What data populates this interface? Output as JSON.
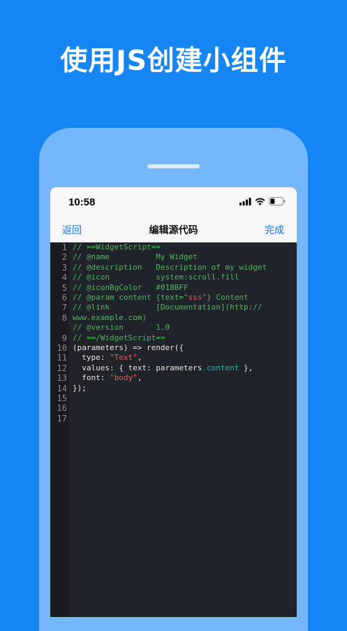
{
  "headline": "使用JS创建小组件",
  "status": {
    "time": "10:58"
  },
  "nav": {
    "back": "返回",
    "title": "编辑源代码",
    "done": "完成"
  },
  "colors": {
    "background": "#1686f5",
    "phone": "#74b8fb",
    "editor_bg": "#21232b",
    "accent": "#1677ee",
    "comment": "#52b560",
    "string": "#e25b5b",
    "property": "#34b0b3"
  },
  "code_lines": [
    {
      "n": "1",
      "segments": [
        {
          "t": "// ==WidgetScript==",
          "k": "comment"
        }
      ]
    },
    {
      "n": "2",
      "segments": [
        {
          "t": "// @name          My Widget",
          "k": "comment"
        }
      ]
    },
    {
      "n": "3",
      "segments": [
        {
          "t": "// @description   Description of my widget",
          "k": "comment"
        }
      ]
    },
    {
      "n": "4",
      "segments": [
        {
          "t": "// @icon          system:scroll.fill",
          "k": "comment"
        }
      ]
    },
    {
      "n": "5",
      "segments": [
        {
          "t": "// @iconBgColor   #018BFF",
          "k": "comment"
        }
      ]
    },
    {
      "n": "6",
      "segments": []
    },
    {
      "n": "7",
      "segments": [
        {
          "t": "// @param content {text=",
          "k": "comment"
        },
        {
          "t": "\"sss\"",
          "k": "string"
        },
        {
          "t": "} Content",
          "k": "comment"
        }
      ]
    },
    {
      "n": "8",
      "segments": [
        {
          "t": "// @link          [Documentation](http://",
          "k": "comment"
        }
      ]
    },
    {
      "n": "",
      "segments": [
        {
          "t": "www.example.com)",
          "k": "comment"
        }
      ]
    },
    {
      "n": "9",
      "segments": [
        {
          "t": "// @version       1.0",
          "k": "comment"
        }
      ]
    },
    {
      "n": "10",
      "segments": [
        {
          "t": "// ==/WidgetScript==",
          "k": "comment"
        }
      ]
    },
    {
      "n": "11",
      "segments": []
    },
    {
      "n": "12",
      "segments": [
        {
          "t": "(parameters) => render({",
          "k": "plain"
        }
      ]
    },
    {
      "n": "13",
      "segments": [
        {
          "t": "  type: ",
          "k": "plain"
        },
        {
          "t": "\"Text\"",
          "k": "string"
        },
        {
          "t": ",",
          "k": "plain"
        }
      ]
    },
    {
      "n": "14",
      "segments": [
        {
          "t": "  values: { text: parameters",
          "k": "plain"
        },
        {
          "t": ".content",
          "k": "prop"
        },
        {
          "t": " },",
          "k": "plain"
        }
      ]
    },
    {
      "n": "15",
      "segments": [
        {
          "t": "  font: ",
          "k": "plain"
        },
        {
          "t": "\"body\"",
          "k": "string"
        },
        {
          "t": ",",
          "k": "plain"
        }
      ]
    },
    {
      "n": "16",
      "segments": [
        {
          "t": "});",
          "k": "plain"
        }
      ]
    },
    {
      "n": "17",
      "segments": []
    }
  ]
}
